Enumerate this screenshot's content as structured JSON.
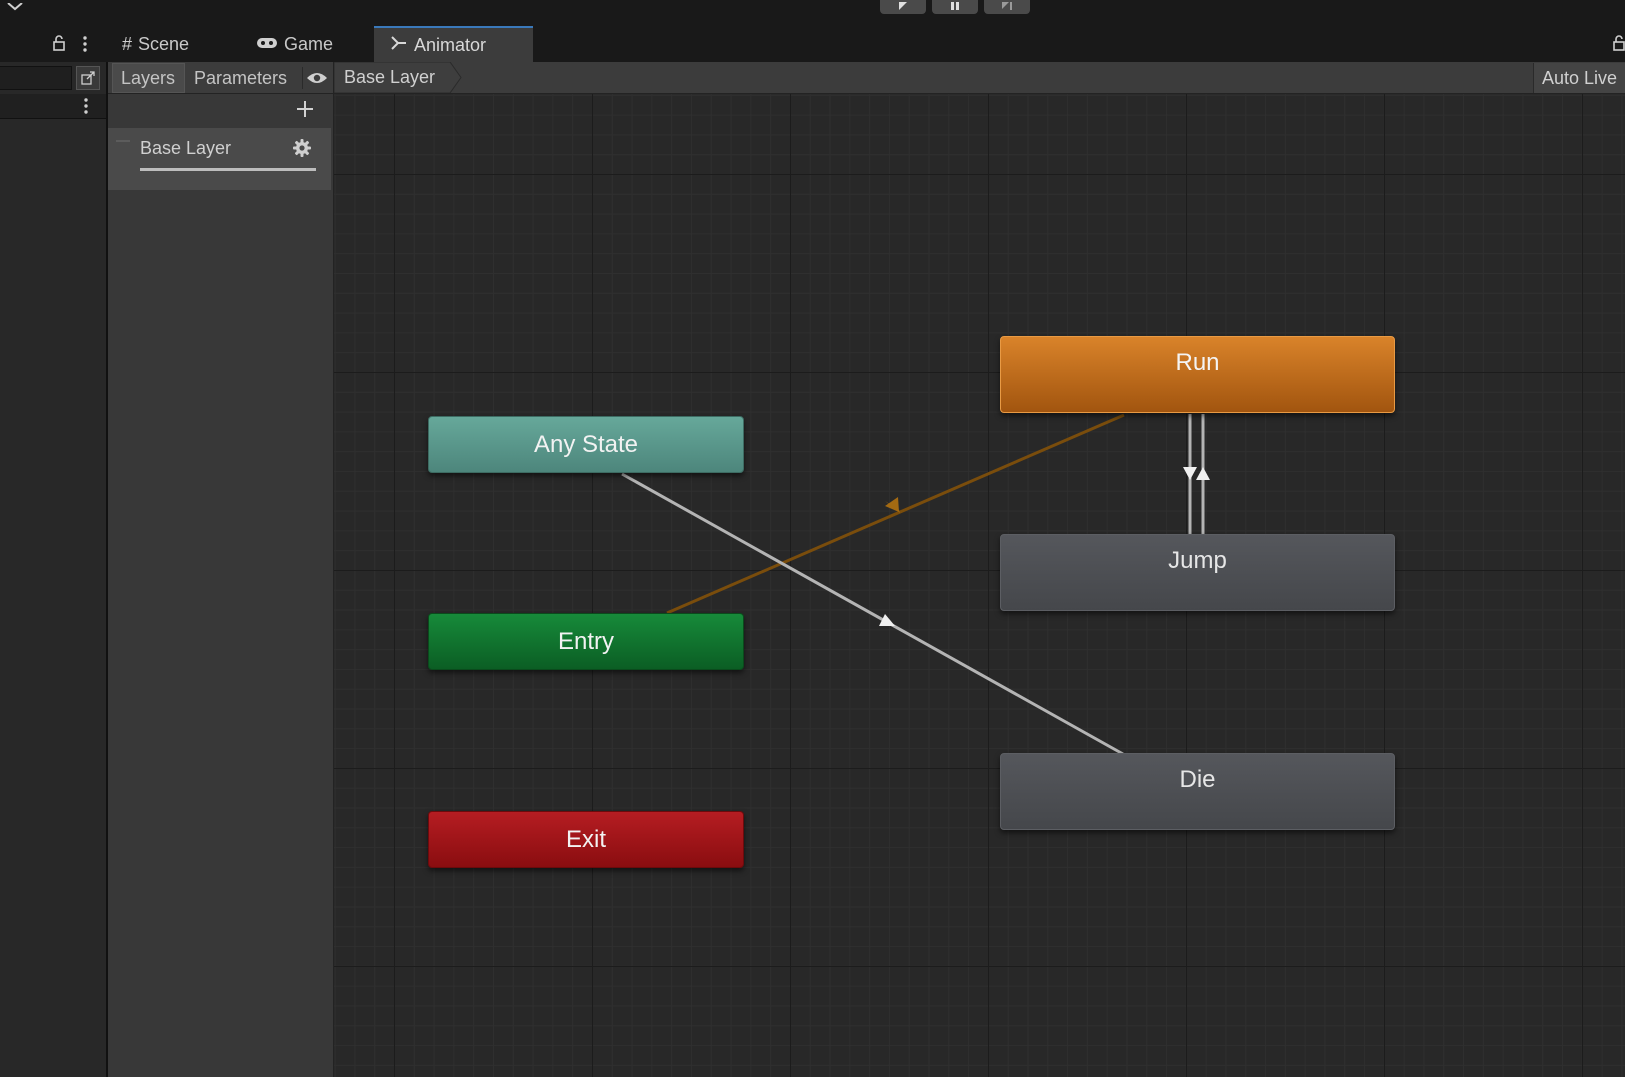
{
  "toolbar": {
    "play_icon": "play-icon",
    "pause_icon": "pause-icon",
    "step_icon": "step-icon"
  },
  "tabs": [
    {
      "label": "Scene",
      "icon": "hash-icon"
    },
    {
      "label": "Game",
      "icon": "gamepad-icon"
    },
    {
      "label": "Animator",
      "icon": "animator-icon",
      "active": true
    }
  ],
  "animator": {
    "subtabs": {
      "layers": "Layers",
      "parameters": "Parameters"
    },
    "breadcrumb": "Base Layer",
    "auto_live": "Auto Live",
    "layers": [
      {
        "name": "Base Layer",
        "weight": 1.0
      }
    ]
  },
  "graph": {
    "nodes": {
      "any_state": "Any State",
      "entry": "Entry",
      "exit": "Exit",
      "run": "Run",
      "jump": "Jump",
      "die": "Die"
    }
  },
  "colors": {
    "any_state": "#5f9e91",
    "entry": "#12752f",
    "exit": "#a8171b",
    "default_state": "#d07a22",
    "state": "#4b4d52",
    "default_transition": "#7a4d0c",
    "transition": "#b4b4b4",
    "accent": "#3a79bb"
  }
}
